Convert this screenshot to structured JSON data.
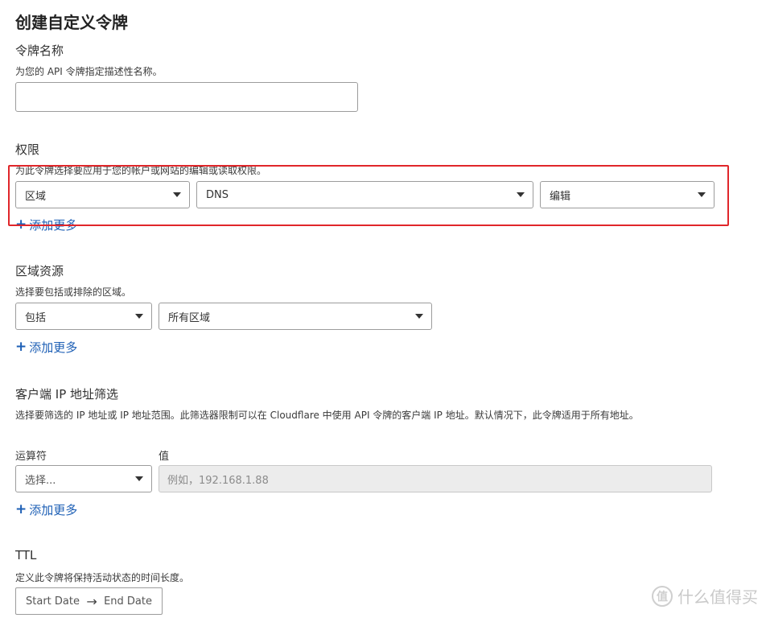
{
  "page": {
    "title": "创建自定义令牌"
  },
  "token_name": {
    "title": "令牌名称",
    "description": "为您的 API 令牌指定描述性名称。",
    "value": ""
  },
  "permissions": {
    "title": "权限",
    "description": "为此令牌选择要应用于您的帐户或网站的编辑或读取权限。",
    "scope_select": "区域",
    "resource_select": "DNS",
    "access_select": "编辑",
    "add_more": "添加更多",
    "highlight_color": "#e0262a"
  },
  "zone_resources": {
    "title": "区域资源",
    "description": "选择要包括或排除的区域。",
    "include_select": "包括",
    "zones_select": "所有区域",
    "add_more": "添加更多"
  },
  "ip_filter": {
    "title": "客户端 IP 地址筛选",
    "description": "选择要筛选的 IP 地址或 IP 地址范围。此筛选器限制可以在 Cloudflare 中使用 API 令牌的客户端 IP 地址。默认情况下，此令牌适用于所有地址。",
    "operator_label": "运算符",
    "value_label": "值",
    "operator_select": "选择...",
    "value_placeholder": "例如，192.168.1.88",
    "add_more": "添加更多"
  },
  "ttl": {
    "title": "TTL",
    "description": "定义此令牌将保持活动状态的时间长度。",
    "start_date": "Start Date",
    "end_date": "End Date",
    "arrow": "→"
  },
  "watermark": {
    "symbol": "值",
    "text": "什么值得买"
  },
  "colors": {
    "link": "#1d5fb5",
    "border": "#9c9c9c"
  }
}
